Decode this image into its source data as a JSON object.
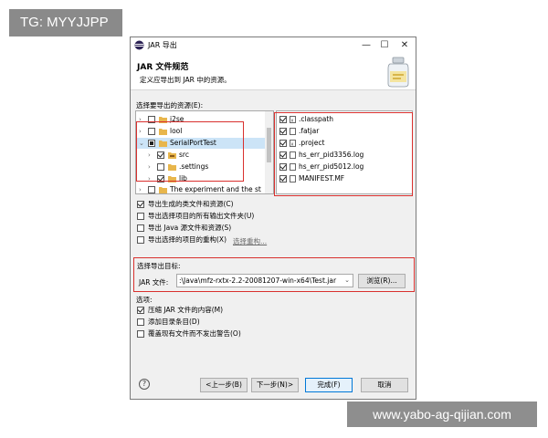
{
  "overlay": {
    "tag": "TG: MYYJJPP",
    "watermark": "www.yabo-ag-qijian.com"
  },
  "window": {
    "title": "JAR 导出",
    "controls": {
      "minimize": "—",
      "maximize": "☐",
      "close": "✕"
    }
  },
  "header": {
    "title": "JAR 文件规范",
    "subtitle": "定义应导出到 JAR 中的资源。"
  },
  "resources": {
    "label": "选择要导出的资源(E):",
    "tree": [
      {
        "label": "j2se",
        "expander": "›",
        "state": "off"
      },
      {
        "label": "lool",
        "expander": "›",
        "state": "off"
      },
      {
        "label": "SerialPortTest",
        "expander": "⌄",
        "state": "partial",
        "selected": true
      },
      {
        "label": "src",
        "expander": "›",
        "state": "on"
      },
      {
        "label": ".settings",
        "expander": "›",
        "state": "off"
      },
      {
        "label": "lib",
        "expander": "›",
        "state": "on"
      },
      {
        "label": "The experiment and the st",
        "expander": "›",
        "state": "off"
      }
    ],
    "files": [
      {
        "label": ".classpath",
        "state": "on"
      },
      {
        "label": ".fatjar",
        "state": "on"
      },
      {
        "label": ".project",
        "state": "on"
      },
      {
        "label": "hs_err_pid3356.log",
        "state": "on"
      },
      {
        "label": "hs_err_pid5012.log",
        "state": "on"
      },
      {
        "label": "MANIFEST.MF",
        "state": "on"
      }
    ]
  },
  "export_options": [
    {
      "label": "导出生成的类文件和资源(C)",
      "state": "on"
    },
    {
      "label": "导出选择项目的所有输出文件夹(U)",
      "state": "off"
    },
    {
      "label": "导出 Java 源文件和资源(S)",
      "state": "off"
    },
    {
      "label": "导出选择的项目的重构(X)",
      "state": "off"
    }
  ],
  "refactor_link": "选择重构...",
  "destination": {
    "label": "选择导出目标:",
    "field_label": "JAR 文件:",
    "value": ":\\Java\\mfz-rxtx-2.2-20081207-win-x64\\Test.jar",
    "browse": "浏览(R)..."
  },
  "options": {
    "label": "选项:",
    "items": [
      {
        "label": "压缩 JAR 文件的内容(M)",
        "state": "on"
      },
      {
        "label": "添加目录条目(D)",
        "state": "off"
      },
      {
        "label": "覆盖现有文件而不发出警告(O)",
        "state": "off"
      }
    ]
  },
  "footer": {
    "help": "?",
    "back": "<上一步(B)",
    "next": "下一步(N)>",
    "finish": "完成(F)",
    "cancel": "取消"
  },
  "colors": {
    "highlight": "#d9302e",
    "selection": "#cce4f7",
    "folder": "#e8b64c"
  }
}
